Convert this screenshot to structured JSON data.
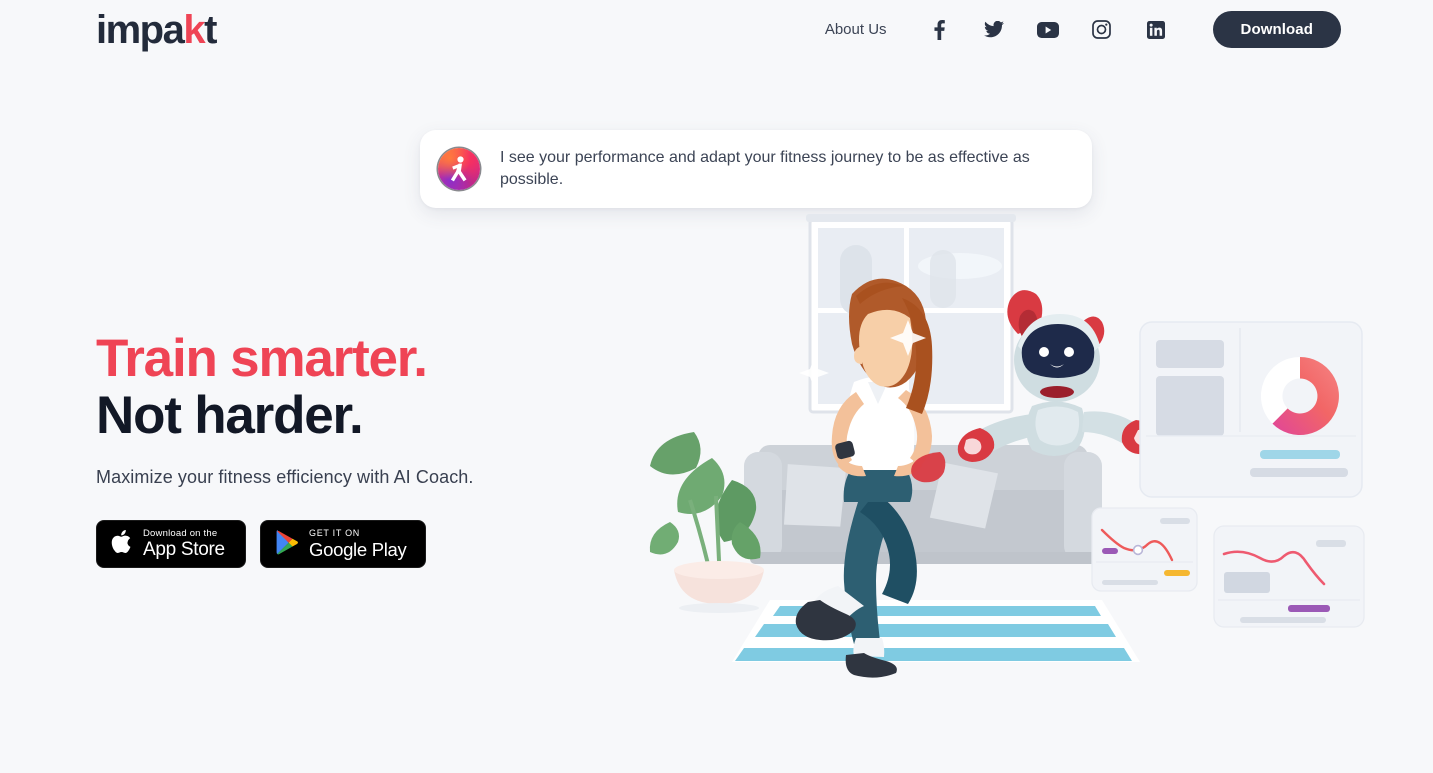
{
  "theme": {
    "background": "#f7f8fa",
    "accent_red": "#ef4455",
    "dark": "#2b3445",
    "text": "#3c4455",
    "mat_blue": "#7fcbe2",
    "chart_purple": "#9b59b6",
    "chart_yellow": "#f5b731"
  },
  "header": {
    "logo_text_before": "impa",
    "logo_text_k": "k",
    "logo_text_after": "t",
    "nav_link": "About Us",
    "download_label": "Download",
    "social": [
      {
        "name": "facebook-icon",
        "label": "Facebook"
      },
      {
        "name": "twitter-icon",
        "label": "Twitter"
      },
      {
        "name": "youtube-icon",
        "label": "YouTube"
      },
      {
        "name": "instagram-icon",
        "label": "Instagram"
      },
      {
        "name": "linkedin-icon",
        "label": "LinkedIn"
      }
    ]
  },
  "chat": {
    "avatar_name": "impakt-ai-coach-avatar",
    "message": "I see your performance and adapt your fitness journey to be as effective as possible."
  },
  "hero": {
    "headline_line1": "Train smarter.",
    "headline_line2": "Not harder.",
    "subhead": "Maximize your fitness efficiency with AI Coach.",
    "app_store": {
      "small": "Download on the",
      "big": "App Store"
    },
    "google_play": {
      "small": "GET IT ON",
      "big": "Google Play"
    }
  },
  "illustration": {
    "name": "woman-exercising-with-ai-robot-and-dashboards",
    "scene_items": [
      "window",
      "sofa",
      "potted-plant",
      "yoga-mat",
      "woman-doing-knee-raise",
      "ai-robot",
      "analytics-dashboard-card",
      "line-chart-card-small",
      "line-chart-card-wide"
    ]
  }
}
